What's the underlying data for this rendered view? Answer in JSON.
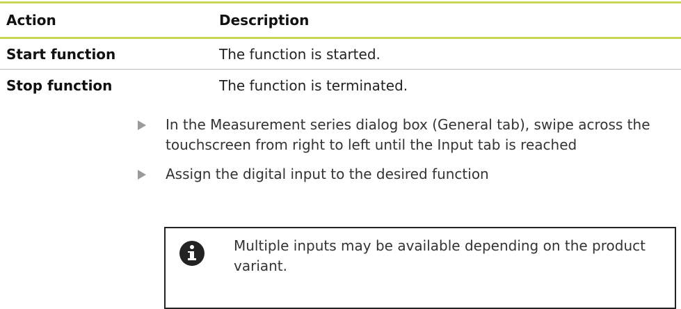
{
  "table": {
    "headers": {
      "action": "Action",
      "description": "Description"
    },
    "rows": [
      {
        "action": "Start function",
        "description": "The function is started."
      },
      {
        "action": "Stop function",
        "description": "The function is terminated."
      }
    ]
  },
  "steps": [
    {
      "text": "In the Measurement series dialog box (General tab), swipe across the touchscreen from right to left until the Input tab is reached"
    },
    {
      "text": "Assign the digital input to the desired function"
    }
  ],
  "note": {
    "icon": "info-icon",
    "text": "Multiple inputs may be available depending on the product variant."
  },
  "colors": {
    "header_rule": "#c8d653",
    "row_rule": "#bdbdbd",
    "step_marker": "#9a9a9a",
    "note_border": "#222222"
  }
}
